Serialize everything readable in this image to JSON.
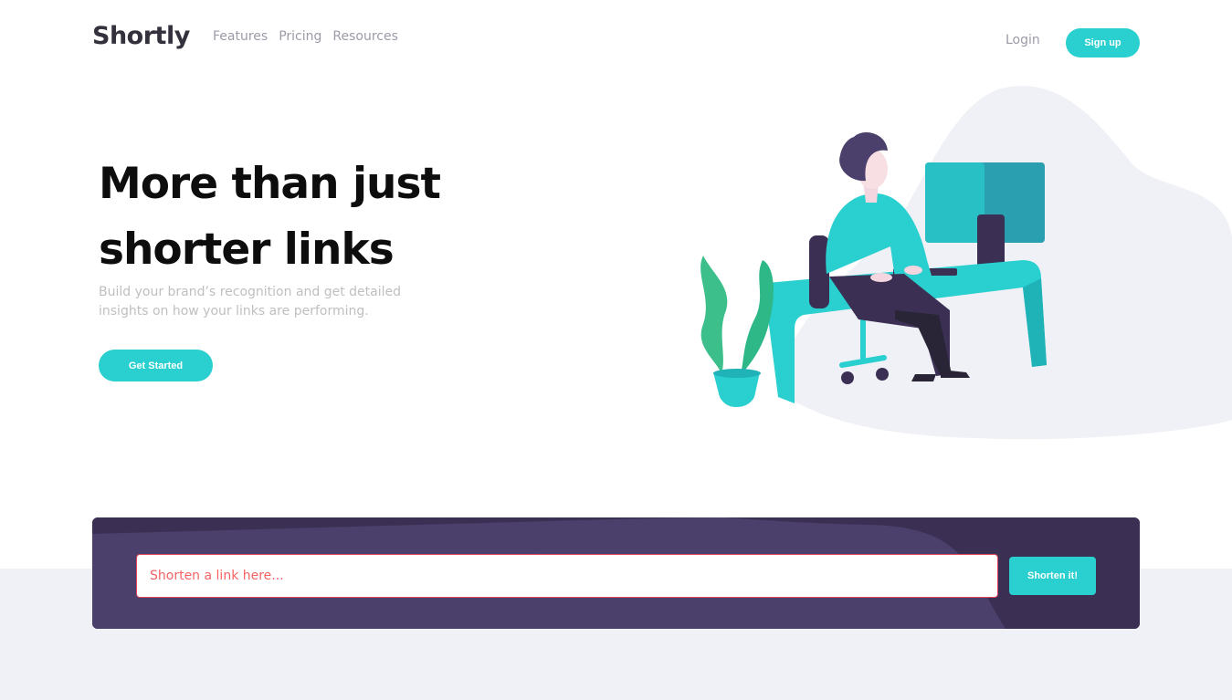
{
  "header": {
    "logo": "Shortly",
    "nav": [
      {
        "label": "Features"
      },
      {
        "label": "Pricing"
      },
      {
        "label": "Resources"
      }
    ],
    "login_label": "Login",
    "signup_label": "Sign up"
  },
  "hero": {
    "title": "More than just shorter links",
    "subtitle": "Build your brand’s recognition and get detailed insights on how your links are performing.",
    "cta_label": "Get Started",
    "illustration": "person-working-at-desk-illustration"
  },
  "shorten": {
    "input_placeholder": "Shorten a link here...",
    "input_value": "",
    "button_label": "Shorten it!"
  },
  "colors": {
    "primary_cyan": "#2acfcf",
    "dark_violet": "#3b3054",
    "panel_violet": "#4b3f6b",
    "error_red": "#f46363",
    "gray_text": "#9e9aa8",
    "light_bg": "#f0f1f6"
  }
}
